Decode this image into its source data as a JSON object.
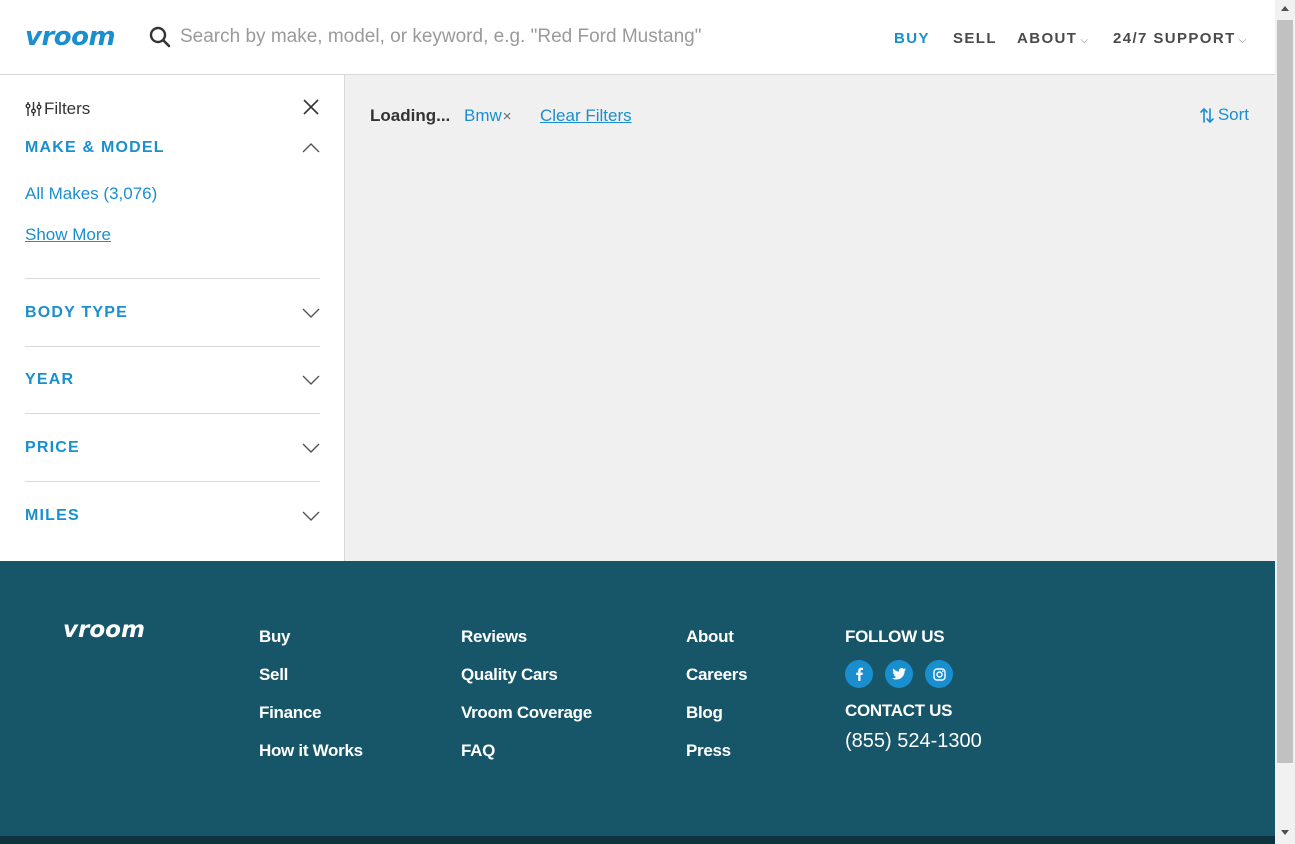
{
  "colors": {
    "brand_blue": "#1a8fcf",
    "footer_bg": "#175668",
    "main_bg": "#f0f0f0",
    "text_dark": "#333333"
  },
  "header": {
    "logo": "vroom",
    "search_placeholder": "Search by make, model, or keyword, e.g. \"Red Ford Mustang\"",
    "nav": {
      "buy": "BUY",
      "sell": "SELL",
      "about": "ABOUT",
      "support": "24/7 SUPPORT"
    }
  },
  "sidebar": {
    "title": "Filters",
    "make_model": {
      "label": "MAKE & MODEL",
      "all_makes": "All Makes (3,076)",
      "show_more": "Show More"
    },
    "sections": {
      "body_type": "BODY TYPE",
      "year": "YEAR",
      "price": "PRICE",
      "miles": "MILES"
    }
  },
  "main": {
    "loading": "Loading...",
    "chip": "Bmw",
    "chip_remove": "×",
    "clear_filters": "Clear Filters",
    "sort": "Sort"
  },
  "footer": {
    "logo": "vroom",
    "col1": [
      "Buy",
      "Sell",
      "Finance",
      "How it Works"
    ],
    "col2": [
      "Reviews",
      "Quality Cars",
      "Vroom Coverage",
      "FAQ"
    ],
    "col3": [
      "About",
      "Careers",
      "Blog",
      "Press"
    ],
    "follow_us": "FOLLOW US",
    "socials": [
      "facebook-icon",
      "twitter-icon",
      "instagram-icon"
    ],
    "contact_us": "CONTACT US",
    "phone": "(855) 524-1300"
  }
}
